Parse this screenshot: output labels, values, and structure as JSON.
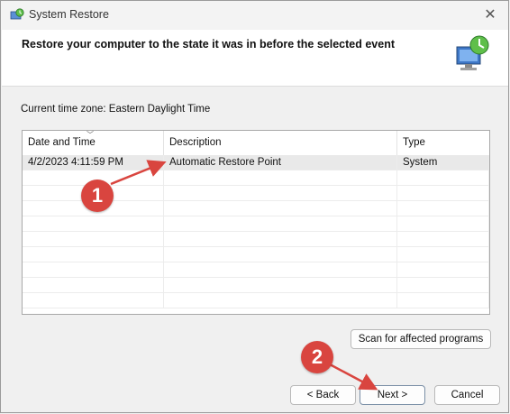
{
  "window": {
    "title": "System Restore"
  },
  "header": {
    "title": "Restore your computer to the state it was in before the selected event"
  },
  "timezone": "Current time zone: Eastern Daylight Time",
  "table": {
    "columns": [
      "Date and Time",
      "Description",
      "Type"
    ],
    "rows": [
      {
        "date": "4/2/2023 4:11:59 PM",
        "description": "Automatic Restore Point",
        "type": "System"
      }
    ]
  },
  "buttons": {
    "scan": "Scan for affected programs",
    "back": "< Back",
    "next": "Next >",
    "cancel": "Cancel"
  },
  "annotations": {
    "marker1": "1",
    "marker2": "2"
  },
  "colors": {
    "annotation": "#d9453f",
    "selected_row": "#e9e9e9"
  },
  "icons": [
    "system-restore-icon",
    "close-icon",
    "sort-arrow-icon",
    "restore-monitor-icon"
  ]
}
